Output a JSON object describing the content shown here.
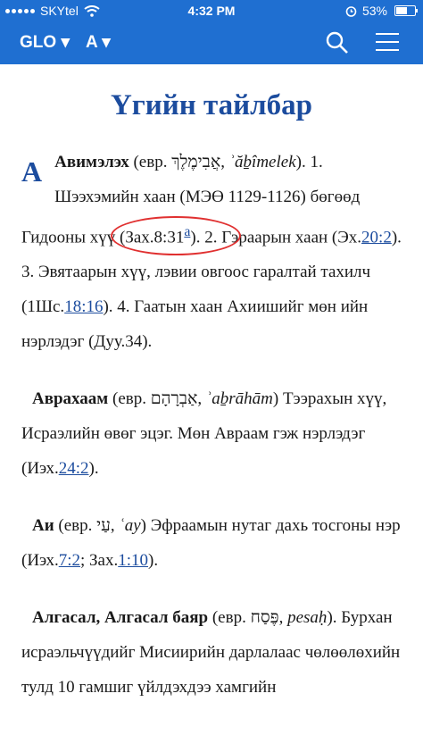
{
  "status": {
    "carrier": "SKYtel",
    "time": "4:32 PM",
    "battery": "53%",
    "battery_level": 0.53
  },
  "nav": {
    "glo_label": "GLO ▾",
    "letter_label": "A ▾",
    "search_icon": "search-icon",
    "menu_icon": "hamburger-menu-icon"
  },
  "page": {
    "title": "Үгийн тайлбар",
    "dropcap": "A",
    "entries": [
      {
        "term": "Авимэлэх",
        "t1": " (евр. ",
        "hebrew": "אֲבִימֶלֶךְ",
        "t2": ", ",
        "translit": "ʾăḇîmelek",
        "t3": "). 1. Шээхэмийн хаан (МЭӨ 1129-1126) бөгөөд Гидооны хүү ",
        "circled_text": "(Зах.8:31",
        "circled_link": "a",
        "t4": "). 2. Гэраарын хаан (Эх.",
        "link1": "20:2",
        "t5": "). 3. Эвятаарын хүү, лэвии овгоос гаралтай тахилч (1Шс.",
        "link2": "18:16",
        "t6": "). 4. Гаатын хаан Ахиишийг мөн ийн нэрлэдэг (Дуу.34)."
      },
      {
        "term": "Аврахаам",
        "t1": " (евр. ",
        "hebrew": "אַבְרָהָם",
        "t2": ", ",
        "translit": "ʾaḇrāhām",
        "t3": ") Тээрахын хүү, Исраэлийн өвөг эцэг. Мөн Авраам гэж нэрлэдэг (Иэх.",
        "link1": "24:2",
        "t4": ")."
      },
      {
        "term": "Аи",
        "t1": " (евр. ",
        "hebrew": "עַי",
        "t2": ", ",
        "translit": "ʿay",
        "t3": ") Эфраамын нутаг дахь тосгоны нэр (Иэх.",
        "link1": "7:2",
        "t4": "; Зах.",
        "link2": "1:10",
        "t5": ")."
      },
      {
        "term": "Алгасал, Алгасал баяр",
        "t1": " (евр. ",
        "hebrew": "פֶּסַח",
        "t2": ", ",
        "translit": "pesaḥ",
        "t3": "). Бурхан исраэльчүүдийг Мисиирийн дарлалаас чөлөөлөхийн тулд 10 гамшиг үйлдэхдээ хамгийн"
      }
    ]
  }
}
